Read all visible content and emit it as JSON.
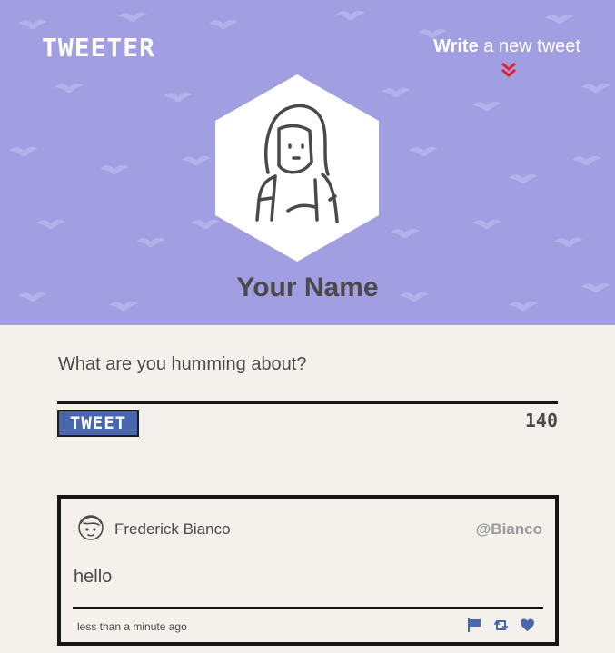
{
  "header": {
    "logo": "TWEETER",
    "write_bold": "Write",
    "write_rest": " a new tweet",
    "user_name": "Your Name",
    "background_color": "#a29ee2"
  },
  "compose": {
    "prompt": "What are you humming about?",
    "button_label": "TWEET",
    "char_count": "140"
  },
  "tweets": [
    {
      "author": "Frederick Bianco",
      "handle": "@Bianco",
      "text": "hello",
      "time": "less than a minute ago",
      "actions": [
        "flag-icon",
        "retweet-icon",
        "heart-icon"
      ]
    }
  ],
  "colors": {
    "accent": "#4a66ac",
    "chevron": "#e0202a",
    "page_bg": "#f4f1ec"
  }
}
